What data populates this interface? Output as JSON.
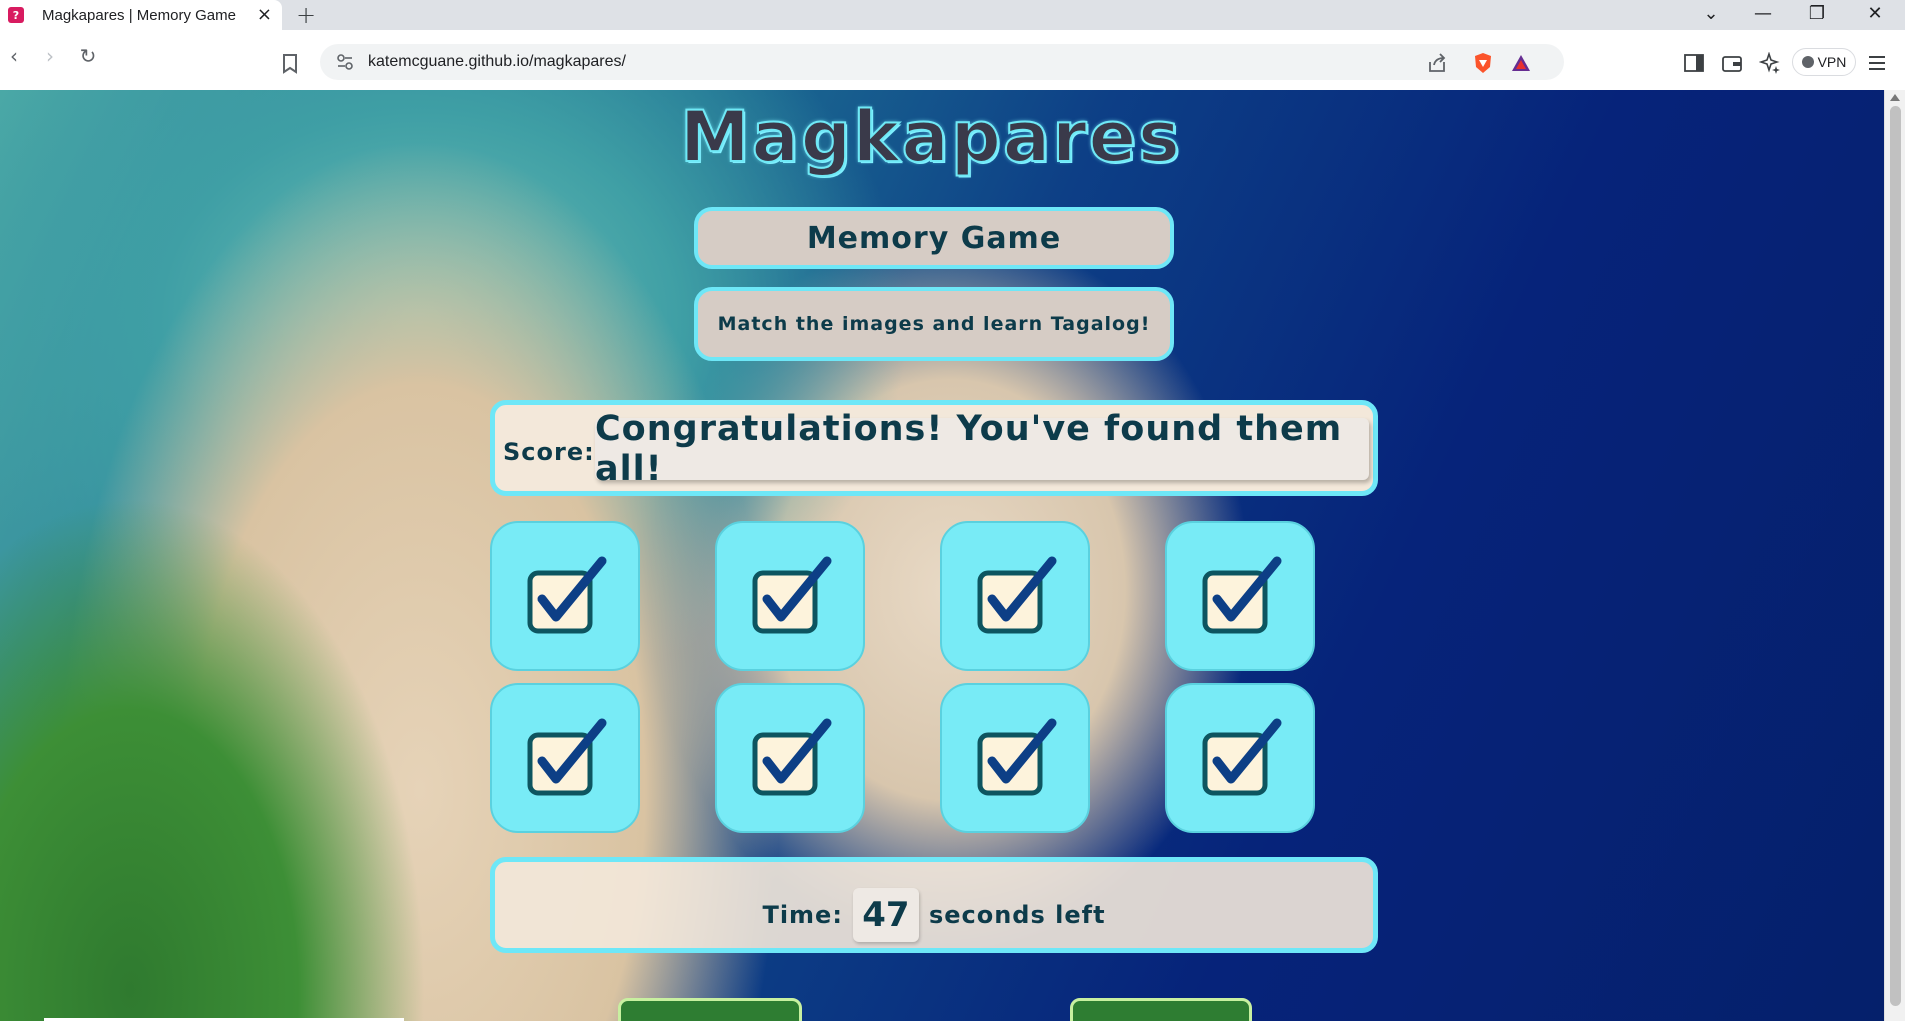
{
  "browser": {
    "tab_title": "Magkapares | Memory Game",
    "favicon_glyph": "?",
    "new_tab_label": "+",
    "url": "katemcguane.github.io/magkapares/",
    "vpn_label": "VPN"
  },
  "page": {
    "logo_text": "Magkapares",
    "title": "Memory Game",
    "subtitle": "Match the images and learn Tagalog!",
    "score_label": "Score:",
    "score_message": "Congratulations! You've found them all!",
    "time_label": "Time:",
    "time_value": "47",
    "time_suffix": "seconds left",
    "cards": [
      {
        "state": "matched",
        "icon": "checkbox-checked-icon"
      },
      {
        "state": "matched",
        "icon": "checkbox-checked-icon"
      },
      {
        "state": "matched",
        "icon": "checkbox-checked-icon"
      },
      {
        "state": "matched",
        "icon": "checkbox-checked-icon"
      },
      {
        "state": "matched",
        "icon": "checkbox-checked-icon"
      },
      {
        "state": "matched",
        "icon": "checkbox-checked-icon"
      },
      {
        "state": "matched",
        "icon": "checkbox-checked-icon"
      },
      {
        "state": "matched",
        "icon": "checkbox-checked-icon"
      }
    ]
  },
  "colors": {
    "accent_cyan": "#6ee7f7",
    "card_bg": "#78ebf6",
    "text_dark": "#0d3b4a",
    "check_blue": "#0d3f86"
  }
}
